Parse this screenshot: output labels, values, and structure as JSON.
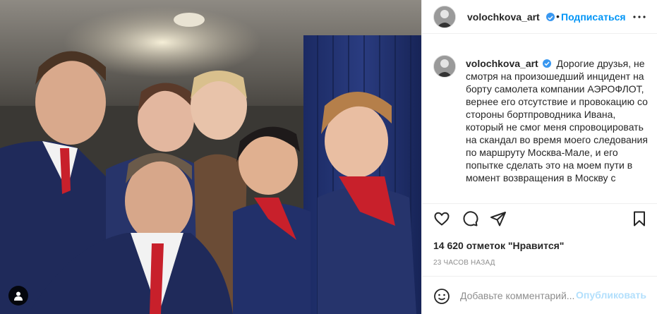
{
  "post": {
    "photo_alt": "",
    "user_tag_icon": "person-icon"
  },
  "header": {
    "username": "volochkova_art",
    "separator": "•",
    "follow_label": "Подписаться",
    "verified_icon": "verified-badge-icon",
    "more_icon": "more-options-icon"
  },
  "caption": {
    "username": "volochkova_art",
    "text": "Дорогие друзья, не смотря на произошедший инцидент на борту самолета компании АЭРОФЛОТ, вернее его отсутствие и провокацию со стороны бортпроводника Ивана, который не смог меня спровоцировать на скандал во время моего следования по маршруту Москва-Мале, и его попытке сделать это на моем пути в момент возвращения в Москву с"
  },
  "actions": {
    "like_icon": "heart-icon",
    "comment_icon": "comment-icon",
    "share_icon": "share-icon",
    "save_icon": "bookmark-icon",
    "likes_text": "14 620 отметок \"Нравится\"",
    "time_ago": "23 часов назад"
  },
  "comment": {
    "emoji_icon": "emoji-icon",
    "placeholder": "Добавьте комментарий...",
    "value": "",
    "publish_label": "Опубликовать"
  },
  "colors": {
    "accent": "#0095f6",
    "verified": "#3897f0",
    "publish_disabled": "#b2dffc",
    "text": "#262626",
    "muted": "#8e8e8e"
  }
}
